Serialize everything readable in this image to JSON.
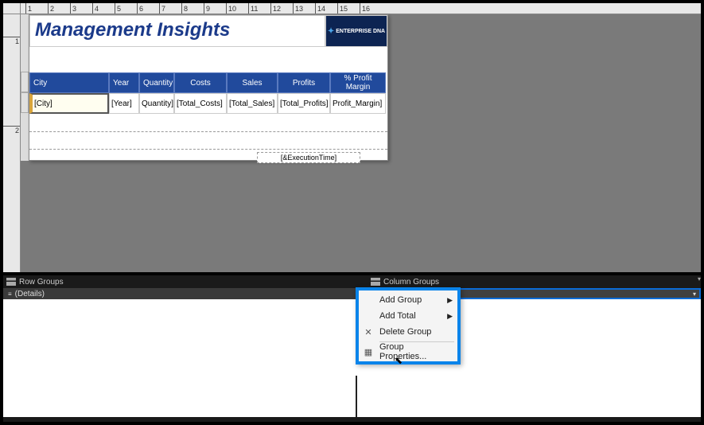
{
  "report": {
    "title": "Management Insights",
    "logo_text": "ENTERPRISE DNA",
    "footer": "[&ExecutionTime]"
  },
  "ruler": {
    "h": [
      "1",
      "2",
      "3",
      "4",
      "5",
      "6",
      "7",
      "8",
      "9",
      "10",
      "11",
      "12",
      "13",
      "14",
      "15",
      "16"
    ],
    "v": [
      "1",
      "2"
    ]
  },
  "table": {
    "headers": {
      "city": "City",
      "year": "Year",
      "qty": "Quantity",
      "costs": "Costs",
      "sales": "Sales",
      "profits": "Profits",
      "margin": "% Profit Margin"
    },
    "row": {
      "city": "[City]",
      "year": "[Year]",
      "qty": "Quantity]",
      "costs": "[Total_Costs]",
      "sales": "[Total_Sales]",
      "profits": "[Total_Profits]",
      "margin": "Profit_Margin]"
    }
  },
  "groupPane": {
    "rowGroupsLabel": "Row Groups",
    "colGroupsLabel": "Column Groups",
    "detailsLabel": "(Details)"
  },
  "menu": {
    "addGroup": "Add Group",
    "addTotal": "Add Total",
    "deleteGroup": "Delete Group",
    "groupProperties": "Group Properties..."
  }
}
